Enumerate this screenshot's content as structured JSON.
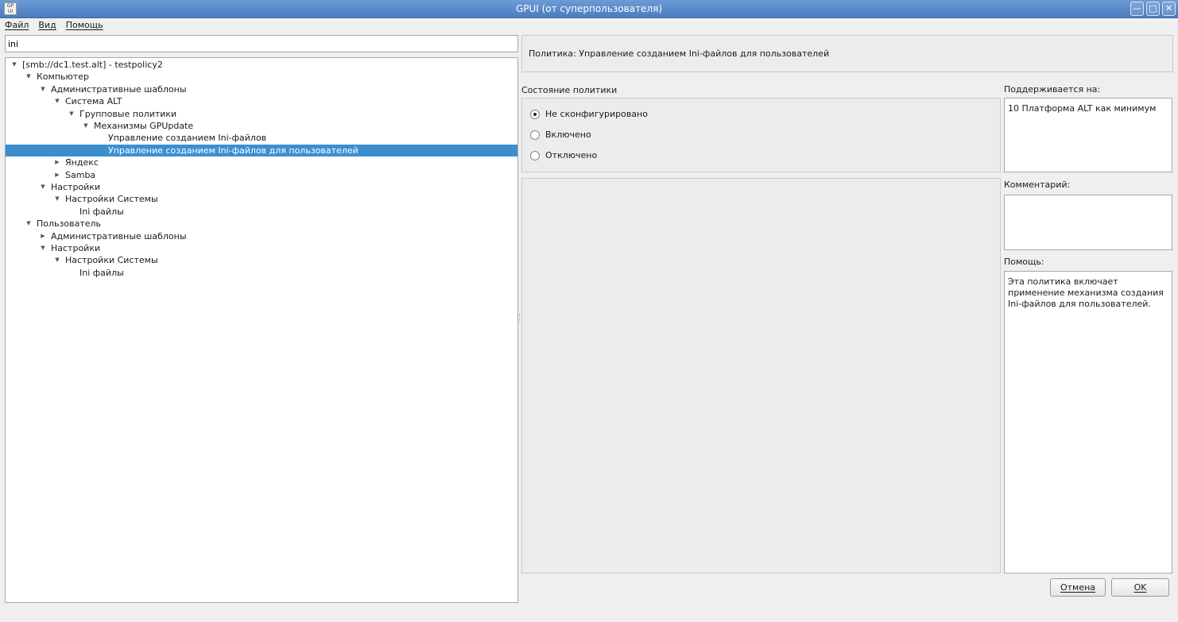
{
  "window": {
    "title": "GPUI (от суперпользователя)",
    "icon_text": "GP UI"
  },
  "window_controls": [
    "minimize-icon",
    "maximize-icon",
    "close-icon"
  ],
  "menu": {
    "items": [
      "Файл",
      "Вид",
      "Помощь"
    ]
  },
  "search": {
    "value": "ini"
  },
  "tree": {
    "nodes": [
      {
        "label": "[smb://dc1.test.alt] - testpolicy2",
        "level": 0,
        "arrow": "expanded"
      },
      {
        "label": "Компьютер",
        "level": 1,
        "arrow": "expanded"
      },
      {
        "label": "Административные шаблоны",
        "level": 2,
        "arrow": "expanded"
      },
      {
        "label": "Система ALT",
        "level": 3,
        "arrow": "expanded"
      },
      {
        "label": "Групповые политики",
        "level": 4,
        "arrow": "expanded"
      },
      {
        "label": "Механизмы GPUpdate",
        "level": 5,
        "arrow": "expanded"
      },
      {
        "label": "Управление созданием Ini-файлов",
        "level": 6,
        "arrow": "none"
      },
      {
        "label": "Управление созданием Ini-файлов для пользователей",
        "level": 6,
        "arrow": "none",
        "selected": true
      },
      {
        "label": "Яндекс",
        "level": 3,
        "arrow": "collapsed"
      },
      {
        "label": "Samba",
        "level": 3,
        "arrow": "collapsed"
      },
      {
        "label": "Настройки",
        "level": 2,
        "arrow": "expanded"
      },
      {
        "label": "Настройки Системы",
        "level": 3,
        "arrow": "expanded"
      },
      {
        "label": "Ini файлы",
        "level": 4,
        "arrow": "none"
      },
      {
        "label": "Пользователь",
        "level": 1,
        "arrow": "expanded"
      },
      {
        "label": "Административные шаблоны",
        "level": 2,
        "arrow": "collapsed"
      },
      {
        "label": "Настройки",
        "level": 2,
        "arrow": "expanded"
      },
      {
        "label": "Настройки Системы",
        "level": 3,
        "arrow": "expanded"
      },
      {
        "label": "Ini файлы",
        "level": 4,
        "arrow": "none"
      }
    ]
  },
  "policy": {
    "header": "Политика: Управление созданием Ini-файлов для пользователей",
    "state_label": "Состояние политики",
    "states": [
      "Не сконфигурировано",
      "Включено",
      "Отключено"
    ],
    "selected_state": "Не сконфигурировано",
    "supported_label": "Поддерживается на:",
    "supported_value": "10 Платформа ALT как минимум",
    "comment_label": "Комментарий:",
    "comment_value": "",
    "help_label": "Помощь:",
    "help_text": "Эта политика включает применение механизма создания Ini-файлов для пользователей."
  },
  "buttons": {
    "cancel": "Отмена",
    "ok": "OK"
  },
  "colors": {
    "titlebar": "#5a8ac9",
    "selection": "#3b8fd1",
    "panel": "#ececec"
  }
}
